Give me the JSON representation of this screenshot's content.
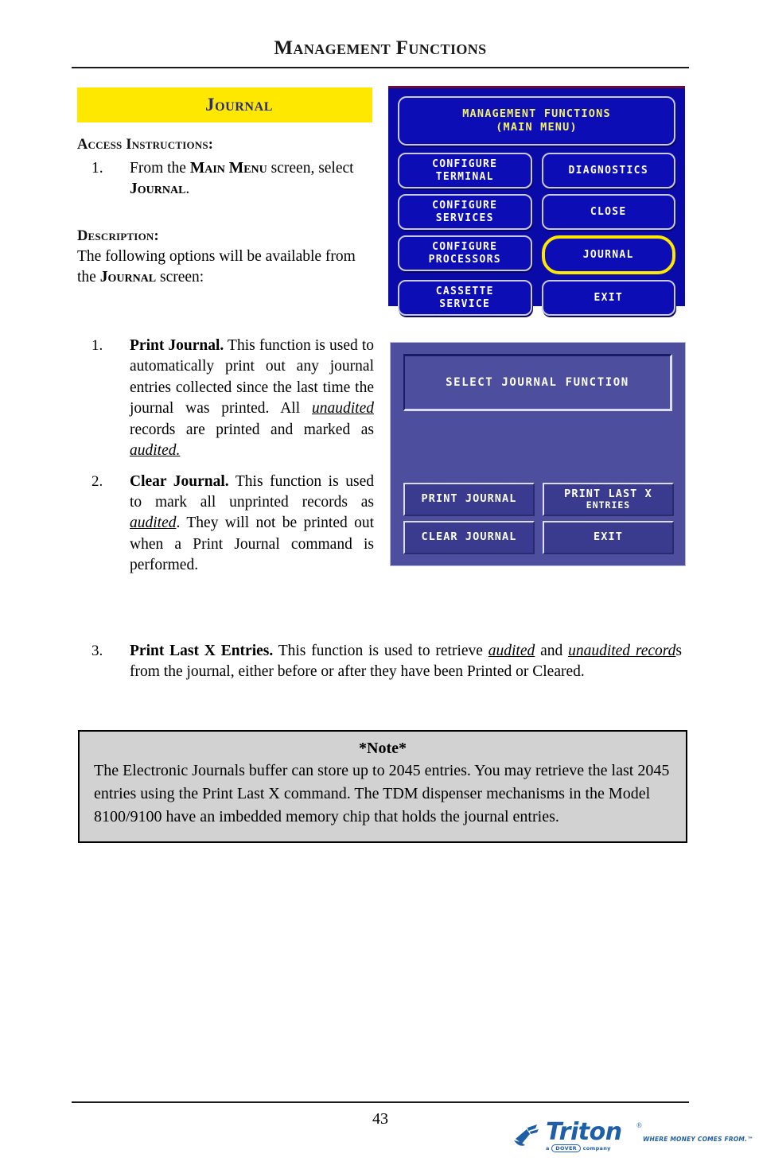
{
  "header": {
    "title": "Management Functions"
  },
  "banner": {
    "label": "Journal"
  },
  "access": {
    "heading": "Access Instructions:",
    "items": [
      {
        "num": "1.",
        "text_a": "From the ",
        "sc_a": "Main Menu",
        "text_b": " screen, select ",
        "sc_b": "Journal",
        "text_c": "."
      }
    ]
  },
  "description": {
    "heading": "Description:",
    "intro_a": "The following options will be available from the ",
    "intro_sc": "Journal",
    "intro_b": " screen:",
    "items": [
      {
        "num": "1.",
        "bold": "Print Journal.",
        "t1": "  This function is used to automatically print out any journal entries collected since the last time the journal was printed. All ",
        "u1": "unaudited",
        "t2": " records are printed and marked as ",
        "u2": "audited.",
        "t3": ""
      },
      {
        "num": "2.",
        "bold": "Clear Journal.",
        "t1": "  This function is used to mark all unprinted records as ",
        "u1": "audited",
        "t2": ". They will not be printed out when a Print Journal command is performed.",
        "u2": "",
        "t3": ""
      }
    ],
    "item3": {
      "num": "3.",
      "bold": "Print Last X Entries.",
      "t1": " This function is used to retrieve ",
      "u1": "audited",
      "t2": " and ",
      "u2": "unaudited record",
      "t3": "s from the journal, either before or after they have been Printed or Cleared."
    }
  },
  "note": {
    "title": "*Note*",
    "body": "The Electronic Journals buffer can store up to 2045 entries.  You may retrieve the last 2045 entries using the Print Last X command. The TDM dispenser mechanisms in the Model 8100/9100 have an imbedded memory chip that holds the journal entries."
  },
  "atm_screen_1": {
    "title_line1": "MANAGEMENT FUNCTIONS",
    "title_line2": "(MAIN MENU)",
    "buttons": [
      {
        "line1": "CONFIGURE",
        "line2": "TERMINAL",
        "highlighted": false
      },
      {
        "line1": "DIAGNOSTICS",
        "line2": "",
        "highlighted": false
      },
      {
        "line1": "CONFIGURE",
        "line2": "SERVICES",
        "highlighted": false
      },
      {
        "line1": "CLOSE",
        "line2": "",
        "highlighted": false
      },
      {
        "line1": "CONFIGURE",
        "line2": "PROCESSORS",
        "highlighted": false
      },
      {
        "line1": "JOURNAL",
        "line2": "",
        "highlighted": true
      },
      {
        "line1": "CASSETTE",
        "line2": "SERVICE",
        "highlighted": false
      },
      {
        "line1": "EXIT",
        "line2": "",
        "highlighted": false
      }
    ],
    "colors": {
      "background": "#0a0aa8",
      "button_fill": "#0d0db5",
      "title_text": "#f2f26a",
      "highlight_ring": "#ffe800"
    }
  },
  "atm_screen_2": {
    "header": "SELECT JOURNAL FUNCTION",
    "buttons": [
      {
        "line1": "PRINT JOURNAL",
        "line2": ""
      },
      {
        "line1": "PRINT LAST X",
        "line2": "ENTRIES"
      },
      {
        "line1": "CLEAR JOURNAL",
        "line2": ""
      },
      {
        "line1": "EXIT",
        "line2": ""
      }
    ],
    "colors": {
      "background": "#4e4e9e",
      "button_fill": "#3a3a8e",
      "text": "#ffffff"
    }
  },
  "footer": {
    "page_number": "43",
    "logo_word": "Triton",
    "logo_registered": "®",
    "logo_tagline": "WHERE MONEY COMES FROM.™",
    "logo_dover_prefix": "a",
    "logo_dover": "DOVER",
    "logo_dover_suffix": "company"
  }
}
